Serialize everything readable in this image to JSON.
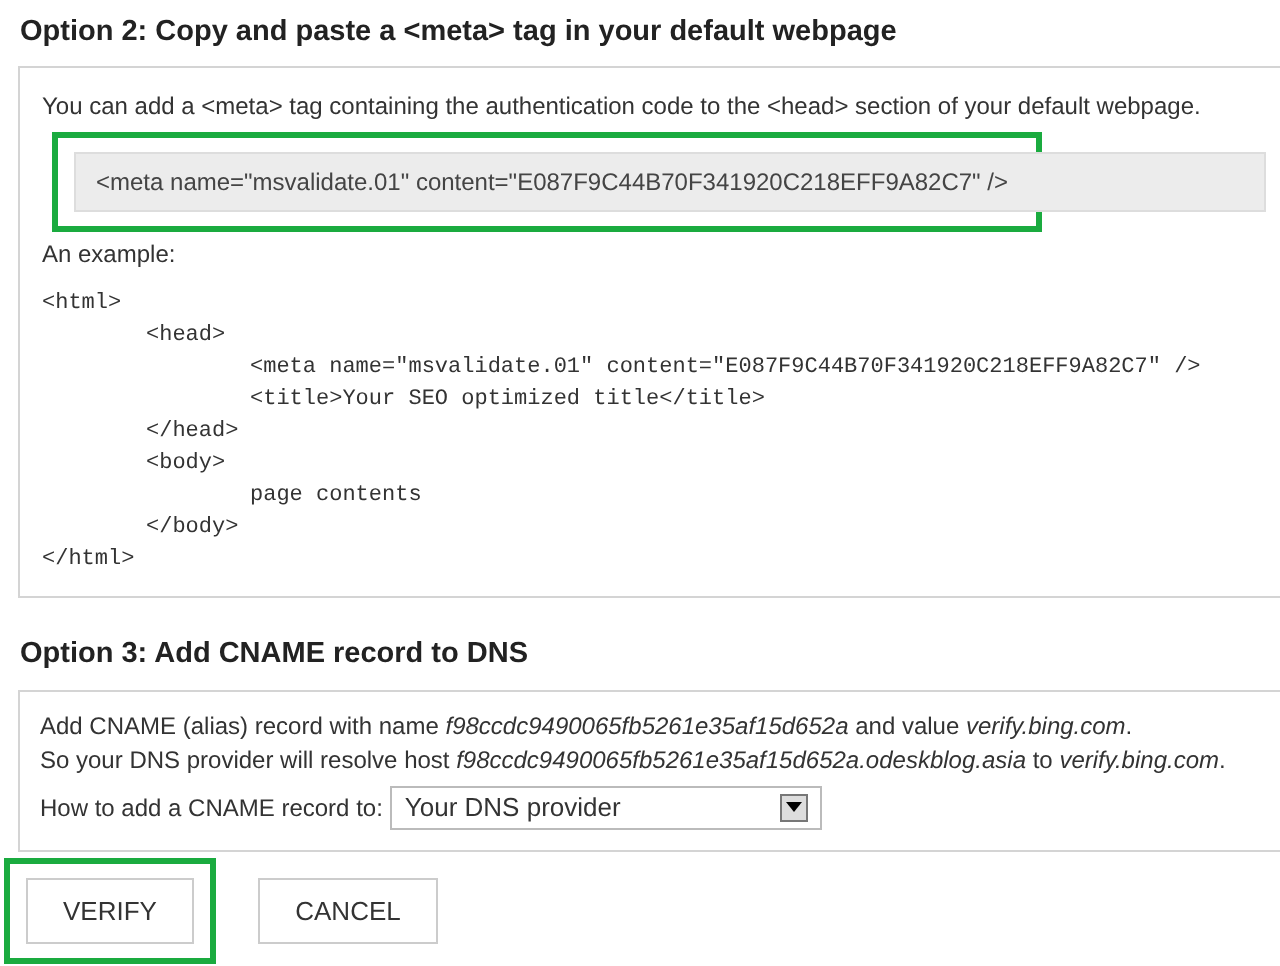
{
  "option2": {
    "heading": "Option 2: Copy and paste a <meta> tag in your default webpage",
    "intro": "You can add a <meta> tag containing the authentication code to the <head> section of your default webpage.",
    "meta_tag": {
      "text": "<meta name=\"msvalidate.01\" content=\"E087F9C44B70F341920C218EFF9A82C7\" />",
      "highlighted": true
    },
    "example_label": "An example:",
    "code": [
      {
        "text": "<html>",
        "children": [
          {
            "text": "<head>",
            "children": [
              {
                "text": "<meta name=\"msvalidate.01\" content=\"E087F9C44B70F341920C218EFF9A82C7\" />"
              },
              {
                "text": "<title>Your SEO optimized title</title>"
              }
            ]
          },
          {
            "text": "</head>"
          },
          {
            "text": "<body>",
            "children": [
              {
                "text": "page contents"
              }
            ]
          },
          {
            "text": "</body>"
          }
        ]
      },
      {
        "text": "</html>"
      }
    ]
  },
  "option3": {
    "heading": "Option 3: Add CNAME record to DNS",
    "lines": [
      "Add CNAME (alias) record with name *f98ccdc9490065fb5261e35af15d652a* and value *verify.bing.com*.",
      "So your DNS provider will resolve host *f98ccdc9490065fb5261e35af15d652a.odeskblog.asia* to *verify.bing.com*."
    ],
    "provider_label": "How to add a CNAME record to:",
    "provider_select": {
      "value": "Your DNS provider"
    }
  },
  "buttons": [
    {
      "label": "VERIFY",
      "highlighted": true
    },
    {
      "label": "CANCEL",
      "highlighted": false
    }
  ]
}
